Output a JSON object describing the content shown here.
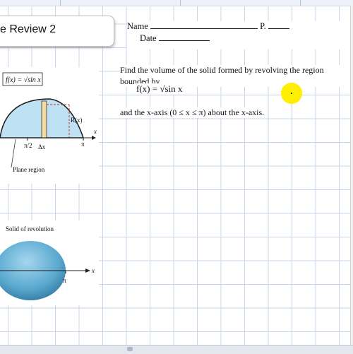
{
  "worksheet": {
    "title": "e Review 2",
    "name_label": "Name",
    "period_label": "P.",
    "date_label": "Date"
  },
  "problem": {
    "text": "Find the volume of the solid formed by revolving the region bounded by",
    "function": "f(x) = √sin x",
    "bounds_text": "and the x-axis (0 ≤ x ≤ π) about the x-axis."
  },
  "figure_top": {
    "function_label": "f(x) = √sin x",
    "radius_label": "R(x)",
    "x_axis_label": "x",
    "half_pi_label": "π/2",
    "pi_label": "π",
    "dx_label": "Δx",
    "caption": "Plane region"
  },
  "figure_bottom": {
    "caption": "Solid of revolution",
    "x_axis_label": "x",
    "pi_label": "π"
  },
  "colors": {
    "region_fill": "#bfe1f4",
    "solid_fill": "#5aa9cf",
    "rect_fill": "#f3dba0",
    "highlight": "#ffee00",
    "grid": "#c9d4ea"
  }
}
